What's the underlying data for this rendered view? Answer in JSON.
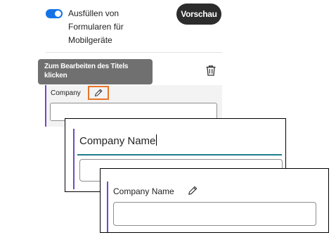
{
  "settings": {
    "mobile_forms_toggle": {
      "label": "Ausfüllen von Formularen für Mobilgeräte",
      "enabled": true
    },
    "preview_button": "Vorschau"
  },
  "field_editor": {
    "tooltip": "Zum Bearbeiten des Titels klicken",
    "field_label": "Company",
    "trash_icon": "trash-icon",
    "edit_icon": "pencil-icon"
  },
  "zoom_editing": {
    "title_value": "Company Name"
  },
  "zoom_result": {
    "field_label": "Company Name"
  },
  "colors": {
    "toggle_on": "#1473e6",
    "accent_bar": "#6e4bc4",
    "highlight_box": "#e8742a",
    "active_underline": "#1f7d8c"
  }
}
